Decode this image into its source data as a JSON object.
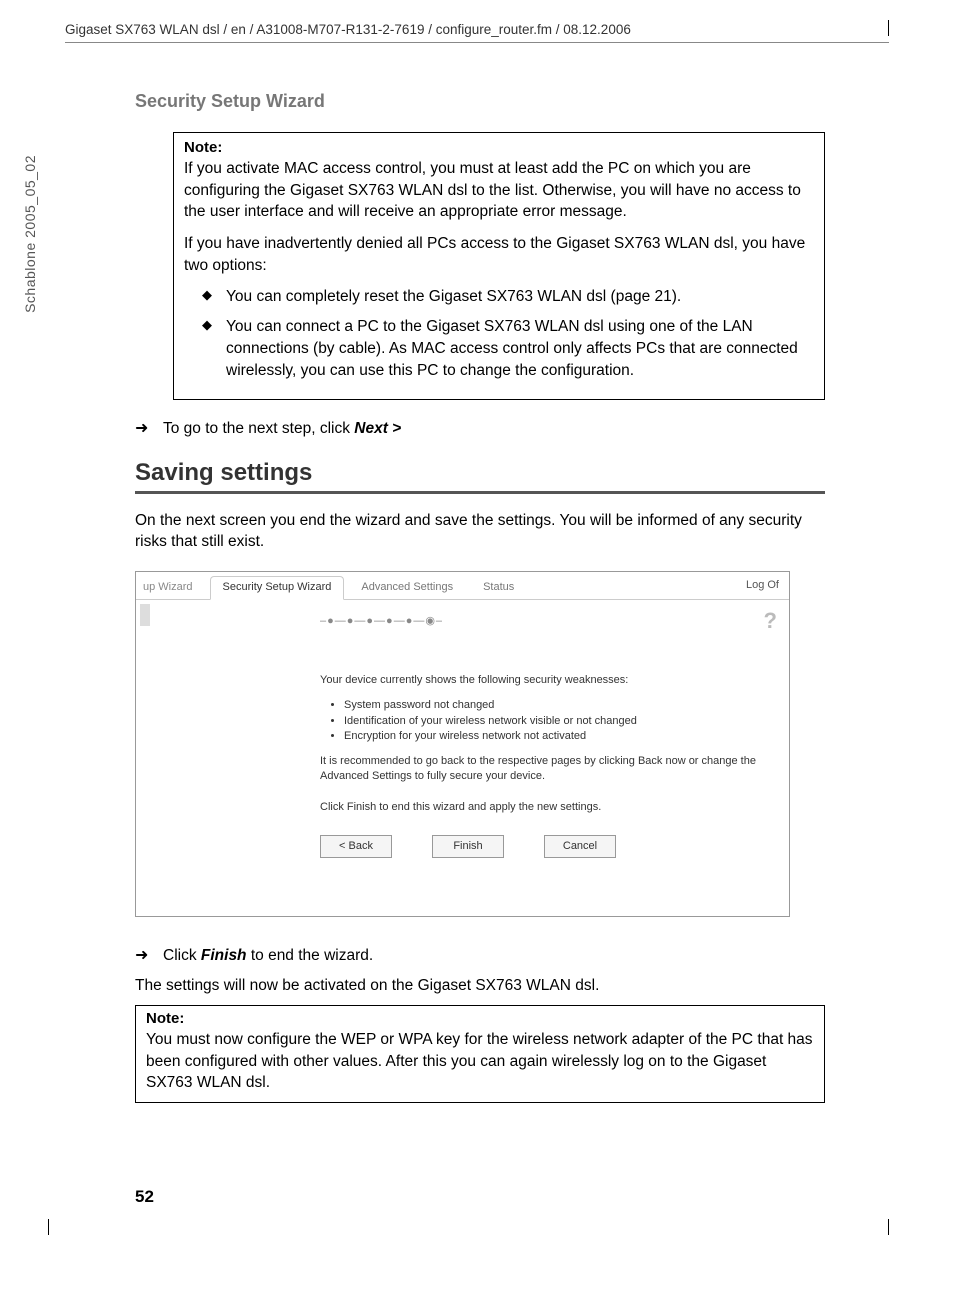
{
  "header": {
    "path": "Gigaset SX763 WLAN dsl / en / A31008-M707-R131-2-7619 / configure_router.fm / 08.12.2006"
  },
  "vertical_label": "Schablone 2005_05_02",
  "section_subtitle": "Security Setup Wizard",
  "note1": {
    "title": "Note:",
    "p1": "If you activate MAC access control, you must at least add the PC on which you are configuring the Gigaset SX763 WLAN dsl to the list. Otherwise, you will have no access to the user interface and will receive an appropriate error message.",
    "p2": "If you have inadvertently denied all PCs access to the Gigaset SX763 WLAN dsl, you have two options:",
    "li1": "You can completely reset the Gigaset SX763 WLAN dsl (page 21).",
    "li2": "You can connect a PC to the Gigaset SX763 WLAN dsl using one of the LAN connections (by cable). As MAC access control only affects PCs that are connected wirelessly, you can use this PC to change the configuration."
  },
  "arrow1": {
    "pre": "To go to the next step, click ",
    "bold": "Next >"
  },
  "h1": "Saving settings",
  "body1": "On the next screen you end the wizard and save the settings. You will be informed of any security risks that still exist.",
  "screenshot": {
    "tabs": {
      "t0": "up Wizard",
      "t1": "Security Setup Wizard",
      "t2": "Advanced Settings",
      "t3": "Status"
    },
    "logoff": "Log Of",
    "stepper": "–●—●—●—●—●—◉–",
    "help": "?",
    "heading": "Your device currently shows the following security weaknesses:",
    "b1": "System password not changed",
    "b2": "Identification of your wireless network visible or not changed",
    "b3": "Encryption for your wireless network not activated",
    "reco": "It is recommended to go back to the respective pages by clicking Back now or change the Advanced Settings to fully secure your device.",
    "finish": "Click Finish to end this wizard and apply the new settings.",
    "btn_back": "< Back",
    "btn_finish": "Finish",
    "btn_cancel": "Cancel"
  },
  "arrow2": {
    "pre": "Click ",
    "bold": "Finish",
    "post": " to end the wizard."
  },
  "body2": "The settings will now be activated on the Gigaset SX763 WLAN dsl.",
  "note2": {
    "title": "Note:",
    "p1": "You must now configure the WEP or WPA key for the wireless network adapter of the PC that has been configured with other values. After this you can again wirelessly log on to the Gigaset SX763 WLAN dsl."
  },
  "page_number": "52"
}
